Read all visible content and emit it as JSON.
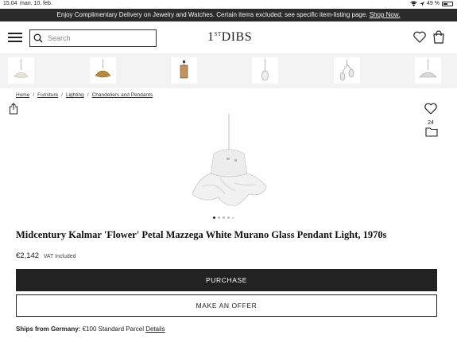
{
  "status_bar": {
    "time": "15.04",
    "date": "man. 10. feb.",
    "battery": "49 %"
  },
  "promo": {
    "text": "Enjoy Complimentary Delivery on Jewelry and Watches. Certain items excluded; see specific item-listing page.",
    "link": "Shop Now."
  },
  "header": {
    "search_placeholder": "Search",
    "logo_prefix": "1",
    "logo_sup": "ST",
    "logo_main": "DIBS"
  },
  "thumbnails": [
    {
      "icon": "pendant-lamp-thumb"
    },
    {
      "icon": "brass-pendant-thumb"
    },
    {
      "icon": "lantern-pendant-thumb"
    },
    {
      "icon": "glass-drop-pendant-thumb"
    },
    {
      "icon": "twin-glass-pendant-thumb"
    },
    {
      "icon": "dome-pendant-thumb"
    }
  ],
  "breadcrumb": [
    "Home",
    "Furniture",
    "Lighting",
    "Chandeliers and Pendants"
  ],
  "favorites": {
    "count": "24"
  },
  "product": {
    "title": "Midcentury Kalmar 'Flower' Petal Mazzega White Murano Glass Pendant Light, 1970s",
    "price": "€2,142",
    "vat": "VAT Included",
    "image_count": 5,
    "active_image": 1
  },
  "actions": {
    "purchase": "PURCHASE",
    "offer": "MAKE AN OFFER"
  },
  "shipping": {
    "label": "Ships from Germany:",
    "text": "€100 Standard Parcel",
    "link": "Details"
  },
  "colors": {
    "promo_bg": "#2b2b2b",
    "primary_button": "#222222",
    "thumb_strip_bg": "#f3f3f3"
  }
}
